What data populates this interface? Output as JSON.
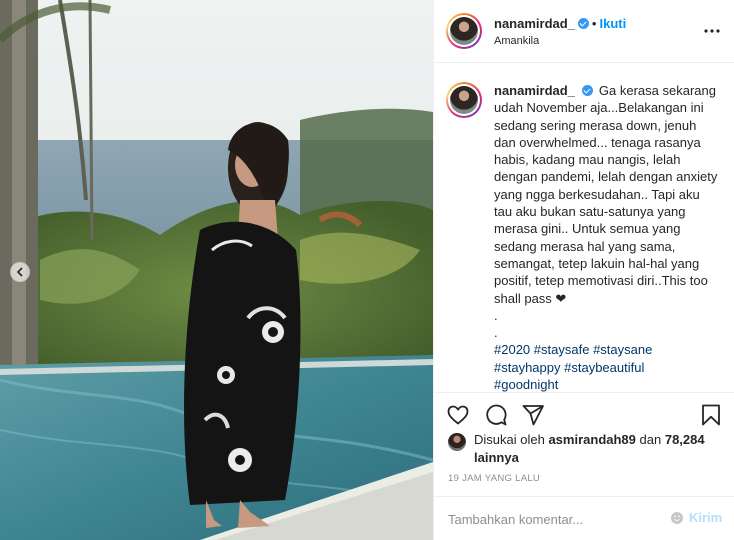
{
  "header": {
    "username": "nanamirdad_",
    "follow_label": "Ikuti",
    "dot": "•",
    "location": "Amankila"
  },
  "caption": {
    "username": "nanamirdad_",
    "text": "Ga kerasa sekarang udah November aja...Belakangan ini sedang sering merasa down, jenuh dan overwhelmed... tenaga rasanya habis, kadang mau nangis, lelah dengan pandemi, lelah dengan anxiety yang ngga berkesudahan.. Tapi aku tau aku bukan satu-satunya yang merasa gini.. Untuk semua yang sedang merasa hal yang sama, semangat, tetep lakuin hal-hal yang positif, tetep memotivasi diri..This too shall pass ❤",
    "dot1": ".",
    "dot2": ".",
    "hashtags": [
      "#2020",
      "#staysafe",
      "#staysane",
      "#stayhappy",
      "#staybeautiful",
      "#goodnight"
    ]
  },
  "likes": {
    "prefix": "Disukai oleh",
    "user": "asmirandah89",
    "middle": "dan",
    "count": "78,284 lainnya"
  },
  "timestamp": "19 JAM YANG LALU",
  "comment": {
    "placeholder": "Tambahkan komentar...",
    "post_label": "Kirim"
  },
  "icons": {
    "like": "heart-icon",
    "comment": "comment-icon",
    "share": "paper-plane-icon",
    "save": "bookmark-icon",
    "more": "more-dots-icon",
    "prev": "chevron-left-icon",
    "emoji": "emoji-icon"
  },
  "colors": {
    "accent": "#0095f6",
    "verified": "#3897f0",
    "hashtag": "#00376b",
    "muted": "#8e8e8e"
  }
}
